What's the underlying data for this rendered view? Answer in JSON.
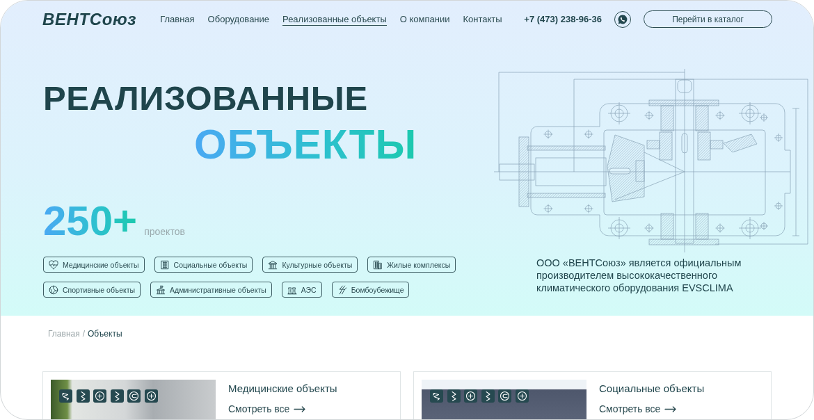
{
  "header": {
    "logo": "ВЕНТСоюз",
    "nav": [
      {
        "label": "Главная",
        "selected": false
      },
      {
        "label": "Оборудование",
        "selected": false
      },
      {
        "label": "Реализованные объекты",
        "selected": true
      },
      {
        "label": "О компании",
        "selected": false
      },
      {
        "label": "Контакты",
        "selected": false
      }
    ],
    "phone": "+7 (473) 238-96-36",
    "catalog_button": "Перейти в каталог"
  },
  "hero": {
    "title": "РЕАЛИЗОВАННЫЕ",
    "title_accent": "ОБЪЕКТЫ",
    "count": "250+",
    "count_label": "проектов",
    "category_rows": [
      [
        {
          "label": "Медицинские объекты",
          "kind": "medical"
        },
        {
          "label": "Социальные объекты",
          "kind": "social"
        },
        {
          "label": "Культурные объекты",
          "kind": "cultural"
        },
        {
          "label": "Жилые комплексы",
          "kind": "residential"
        }
      ],
      [
        {
          "label": "Спортивные объекты",
          "kind": "sports"
        },
        {
          "label": "Административные объекты",
          "kind": "administrative"
        },
        {
          "label": "АЭС",
          "kind": "nuclear"
        },
        {
          "label": "Бомбоубежище",
          "kind": "shelter"
        }
      ]
    ],
    "description": "ООО «ВЕНТСоюз» является официальным производителем высококачественного климатического оборудования EVSCLIMA"
  },
  "breadcrumb": {
    "separator": "/",
    "items": [
      {
        "label": "Главная",
        "current": false
      },
      {
        "label": "Объекты",
        "current": true
      }
    ]
  },
  "cards": [
    {
      "title": "Медицинские объекты",
      "link": "Смотреть все",
      "features": [
        {
          "kind": "arrows"
        },
        {
          "kind": "zigzag"
        },
        {
          "kind": "plus"
        },
        {
          "kind": "zigzag"
        },
        {
          "kind": "gauge"
        },
        {
          "kind": "plus"
        }
      ]
    },
    {
      "title": "Социальные объекты",
      "link": "Смотреть все",
      "features": [
        {
          "kind": "arrows"
        },
        {
          "kind": "zigzag"
        },
        {
          "kind": "plus"
        },
        {
          "kind": "zigzag"
        },
        {
          "kind": "gauge"
        },
        {
          "kind": "plus"
        }
      ]
    }
  ]
}
